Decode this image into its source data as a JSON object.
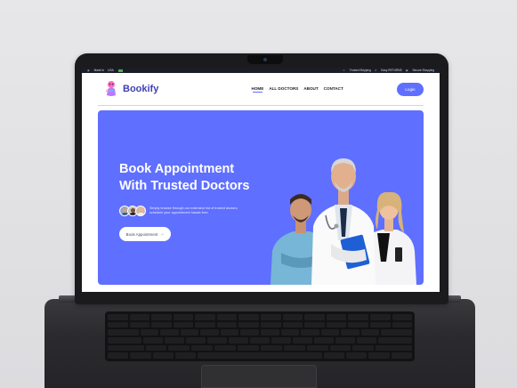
{
  "topbar": {
    "left_label": "Made In",
    "left_country": "USA",
    "right_items": [
      {
        "icon": "truck-icon",
        "label": "Trusted Shipping"
      },
      {
        "icon": "return-icon",
        "label": "Easy RETURNS"
      },
      {
        "icon": "lock-icon",
        "label": "Secure Shopping"
      }
    ]
  },
  "brand": {
    "name": "Bookify",
    "logo_icon": "doctor-mascot-icon"
  },
  "nav": {
    "links": [
      {
        "label": "HOME",
        "active": true
      },
      {
        "label": "ALL DOCTORS",
        "active": false
      },
      {
        "label": "ABOUT",
        "active": false
      },
      {
        "label": "CONTACT",
        "active": false
      }
    ],
    "login_label": "Login"
  },
  "hero": {
    "title_line1": "Book Appointment",
    "title_line2": "With Trusted Doctors",
    "subtitle": "Simply browse through our extensive list of trusted doctors, schedule your appointment hassle-free.",
    "cta_label": "Book Appointment",
    "cta_icon": "arrow-right-icon",
    "avatar_icons": [
      "doctor-avatar-1",
      "doctor-avatar-2",
      "doctor-avatar-3"
    ]
  },
  "colors": {
    "accent": "#5f6fff",
    "brand_text": "#3f3fb3",
    "topbar_bg": "#1a1d26"
  }
}
